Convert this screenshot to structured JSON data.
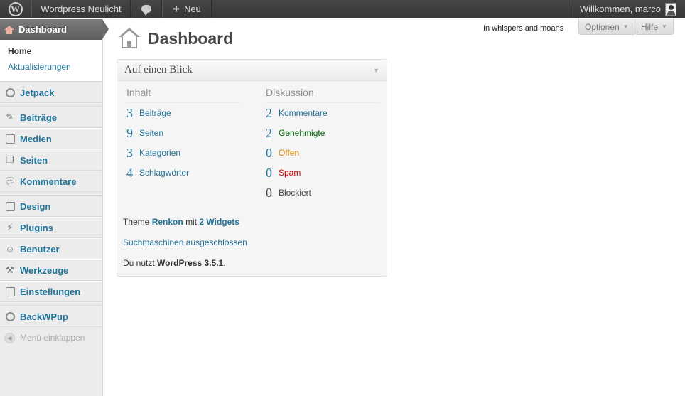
{
  "admin_bar": {
    "wp_logo": "W",
    "site_name": "Wordpress Neulicht",
    "comments_icon": "speech-bubble",
    "new_label": "Neu",
    "account_label": "Willkommen, marco"
  },
  "sidebar": {
    "current": "Dashboard",
    "submenu": [
      "Home",
      "Aktualisierungen"
    ],
    "items": {
      "jetpack": "Jetpack",
      "beitraege": "Beiträge",
      "medien": "Medien",
      "seiten": "Seiten",
      "kommentare": "Kommentare",
      "design": "Design",
      "plugins": "Plugins",
      "benutzer": "Benutzer",
      "werkzeuge": "Werkzeuge",
      "einstellungen": "Einstellungen",
      "backwpup": "BackWPup"
    },
    "collapse_label": "Menü einklappen"
  },
  "header": {
    "title": "Dashboard",
    "tagline": "In whispers and moans",
    "options_label": "Optionen",
    "help_label": "Hilfe"
  },
  "widget": {
    "title": "Auf einen Blick",
    "content": {
      "heading": "Inhalt",
      "posts": {
        "num": "3",
        "label": "Beiträge"
      },
      "pages": {
        "num": "9",
        "label": "Seiten"
      },
      "categories": {
        "num": "3",
        "label": "Kategorien"
      },
      "tags": {
        "num": "4",
        "label": "Schlagwörter"
      }
    },
    "discussion": {
      "heading": "Diskussion",
      "comments": {
        "num": "2",
        "label": "Kommentare"
      },
      "approved": {
        "num": "2",
        "label": "Genehmigte"
      },
      "pending": {
        "num": "0",
        "label": "Offen"
      },
      "spam": {
        "num": "0",
        "label": "Spam"
      },
      "blocked": {
        "num": "0",
        "label": "Blockiert"
      }
    },
    "theme_prefix": "Theme",
    "theme_name": "Renkon",
    "theme_mid": "mit",
    "widgets_link": "2 Widgets",
    "search_engines": "Suchmaschinen ausgeschlossen",
    "version_prefix": "Du nutzt",
    "version": "WordPress 3.5.1"
  },
  "colors": {
    "link": "#21759b",
    "approved": "#006505",
    "pending": "#d98500",
    "spam": "#cc0000",
    "admin_bar": "#464646"
  }
}
